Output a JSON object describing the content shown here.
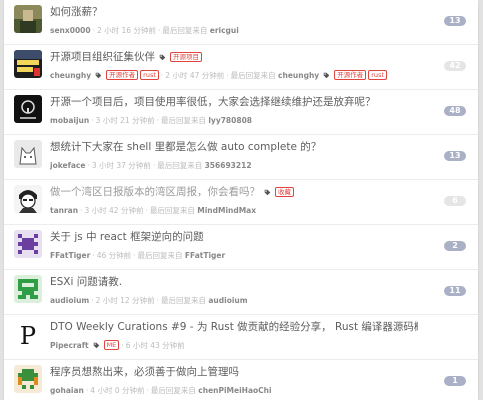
{
  "topics": [
    {
      "title": "如何涨薪？",
      "author": "senx0000",
      "time": "2 小时 16 分钟前",
      "last_label": "最后回复来自",
      "last_user": "ericgui",
      "tags": [],
      "count": "13",
      "faded": false
    },
    {
      "title": "开源项目组织征集伙伴",
      "author": "cheunghy",
      "time": "2 小时 47 分钟前",
      "last_label": "最后回复来自",
      "last_user": "cheunghy",
      "tags": [
        "开源项目"
      ],
      "meta_tags": [
        "开源作者",
        "rust"
      ],
      "last_tags": [
        "开源作者",
        "rust"
      ],
      "count": "42",
      "faded": true
    },
    {
      "title": "开源一个项目后，项目使用率很低，大家会选择继续维护还是放弃呢？",
      "author": "mobaijun",
      "time": "3 小时 21 分钟前",
      "last_label": "最后回复来自",
      "last_user": "lyy780808",
      "tags": [],
      "count": "48",
      "faded": false
    },
    {
      "title": "想统计下大家在 shell 里都是怎么做 auto complete 的？",
      "author": "jokeface",
      "time": "3 小时 37 分钟前",
      "last_label": "最后回复来自",
      "last_user": "356693212",
      "tags": [],
      "count": "13",
      "faded": false
    },
    {
      "title": "做一个湾区日报版本的湾区周报，你会看吗？",
      "author": "tanran",
      "time": "3 小时 42 分钟前",
      "last_label": "最后回复来自",
      "last_user": "MindMindMax",
      "tags": [
        "收藏"
      ],
      "count": "6",
      "faded": true
    },
    {
      "title": "关于 js 中 react 框架逆向的问题",
      "author": "FFatTiger",
      "time": "46 分钟前",
      "last_label": "最后回复来自",
      "last_user": "FFatTiger",
      "tags": [],
      "count": "2",
      "faded": false
    },
    {
      "title": "ESXi 问题请教.",
      "author": "audioium",
      "time": "2 小时 12 分钟前",
      "last_label": "最后回复来自",
      "last_user": "audioium",
      "tags": [],
      "count": "11",
      "faded": false
    },
    {
      "title": "DTO Weekly Curations #9 - 为 Rust 做贡献的经验分享， Rust 编译器源码概要",
      "author": "Pipecraft",
      "time": "6 小时 43 分钟前",
      "last_label": "",
      "last_user": "",
      "tags": [
        "周刊"
      ],
      "meta_tags": [
        "ME"
      ],
      "count": "",
      "faded": false
    },
    {
      "title": "程序员想熬出来，必须善于做向上管理吗",
      "author": "gohaian",
      "time": "4 小时 0 分钟前",
      "last_label": "最后回复来自",
      "last_user": "chenPiMeiHaoChi",
      "tags": [],
      "count": "1",
      "faded": false
    }
  ],
  "colors": {
    "count_bg": "#aab0c6",
    "tag_red": "#e0443e",
    "title": "#5d5d5d"
  }
}
